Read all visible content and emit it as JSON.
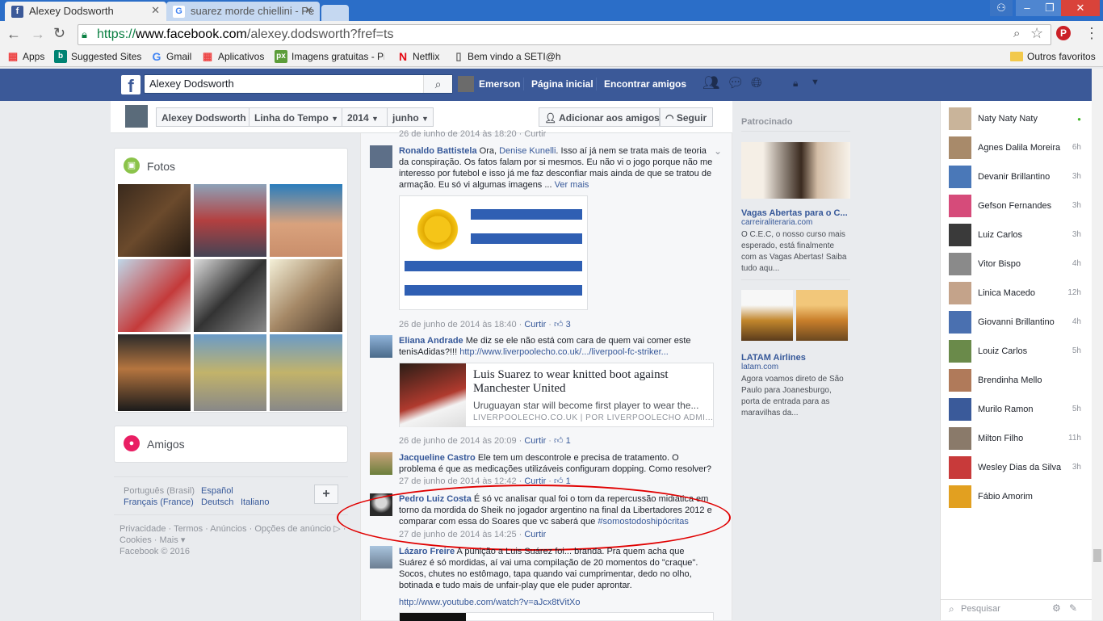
{
  "browser": {
    "tabs": [
      {
        "label": "Alexey Dodsworth"
      },
      {
        "label": "suarez morde chiellini - Pe"
      }
    ],
    "url_secure": "https://",
    "url_domain": "www.facebook.com",
    "url_path": "/alexey.dodsworth?fref=ts",
    "bookmarks": [
      "Apps",
      "Suggested Sites",
      "Gmail",
      "Aplicativos",
      "Imagens gratuitas - Pi",
      "Netflix",
      "Bem vindo a SETI@ho",
      "Outros favoritos"
    ]
  },
  "fb": {
    "search_value": "Alexey Dodsworth",
    "user": "Emerson",
    "nav_home": "Página inicial",
    "nav_friends": "Encontrar amigos"
  },
  "timeline": {
    "name": "Alexey Dodsworth",
    "tab": "Linha do Tempo",
    "year": "2014",
    "month": "junho",
    "add_friend": "Adicionar aos amigos",
    "follow": "Seguir"
  },
  "left": {
    "photos_title": "Fotos",
    "friends_title": "Amigos",
    "languages": [
      "Português (Brasil)",
      "Español",
      "Français (France)",
      "Deutsch",
      "Italiano"
    ],
    "footer_links": [
      "Privacidade",
      "Termos",
      "Anúncios",
      "Opções de anúncio",
      "Cookies",
      "Mais"
    ],
    "copyright": "Facebook © 2016"
  },
  "comments": {
    "top_meta": "26 de junho de 2014 às 18:20 · Curtir",
    "c1_name": "Ronaldo Battistela",
    "c1_text": "Ora, ",
    "c1_mention": "Denise Kunelli",
    "c1_text2": ". Isso aí já nem se trata mais de teoria da conspiração. Os fatos falam por si mesmos. Eu não vi o jogo porque não me interesso por futebol e isso já me faz desconfiar mais ainda de que se tratou de armação. Eu só vi algumas imagens ... ",
    "c1_more": "Ver mais",
    "c1_date": "26 de junho de 2014 às 18:40",
    "c1_like": "Curtir",
    "c1_likes": "3",
    "c2_name": "Eliana Andrade",
    "c2_text": "Me diz se ele não está com cara de quem vai comer este tenisAdidas?!!! ",
    "c2_link": "http://www.liverpoolecho.co.uk/.../liverpool-fc-striker...",
    "c2_card_title": "Luis Suarez to wear knitted boot against Manchester United",
    "c2_card_desc": "Uruguayan star will become first player to wear the...",
    "c2_card_src": "LIVERPOOLECHO.CO.UK | POR LIVERPOOLECHO ADMI...",
    "c2_date": "26 de junho de 2014 às 20:09",
    "c2_like": "Curtir",
    "c2_likes": "1",
    "c3_name": "Jacqueline Castro",
    "c3_text": "Ele tem um descontrole e precisa de tratamento. O problema é que as medicações utilizáveis configuram dopping. Como resolver?",
    "c3_date": "27 de junho de 2014 às 12:42",
    "c3_like": "Curtir",
    "c3_likes": "1",
    "c4_name": "Pedro Luiz Costa",
    "c4_text": "É só vc analisar qual foi o tom da repercussão midiática em torno da mordida do Sheik no jogador argentino na final da Libertadores 2012 e comparar com essa do Soares que vc saberá que ",
    "c4_tag": "#somostodoshipócritas",
    "c4_date": "27 de junho de 2014 às 14:25",
    "c4_like": "Curtir",
    "c5_name": "Lázaro Freire",
    "c5_text": "A punição a Luis Suárez foi... branda. Pra quem acha que Suárez é só mordidas, aí vai uma compilação de 20 momentos do \"craque\". Socos, chutes no estômago, tapa quando vai cumprimentar, dedo no olho, botinada e tudo mais de unfair-play que ele puder aprontar.",
    "c5_link": "http://www.youtube.com/watch?v=aJcx8tVitXo"
  },
  "sponsored": {
    "title": "Patrocinado",
    "ad1_title": "Vagas Abertas para o C...",
    "ad1_domain": "carreiraliteraria.com",
    "ad1_text": "O C.E.C, o nosso curso mais esperado, está finalmente com as Vagas Abertas! Saiba tudo aqu...",
    "ad2_title": "LATAM Airlines",
    "ad2_domain": "latam.com",
    "ad2_text": "Agora voamos direto de São Paulo para Joanesburgo, porta de entrada para as maravilhas da..."
  },
  "chat": {
    "items": [
      {
        "name": "Naty Naty Naty",
        "time": "●"
      },
      {
        "name": "Agnes Dalila Moreira",
        "time": "6h"
      },
      {
        "name": "Devanir Brillantino",
        "time": "3h"
      },
      {
        "name": "Gefson Fernandes",
        "time": "3h"
      },
      {
        "name": "Luiz Carlos",
        "time": "3h"
      },
      {
        "name": "Vitor Bispo",
        "time": "4h"
      },
      {
        "name": "Linica Macedo",
        "time": "12h"
      },
      {
        "name": "Giovanni Brillantino",
        "time": "4h"
      },
      {
        "name": "Louiz Carlos",
        "time": "5h"
      },
      {
        "name": "Brendinha Mello",
        "time": ""
      },
      {
        "name": "Murilo Ramon",
        "time": "5h"
      },
      {
        "name": "Milton Filho",
        "time": "11h"
      },
      {
        "name": "Wesley Dias da Silva",
        "time": "3h"
      },
      {
        "name": "Fábio Amorim",
        "time": ""
      }
    ],
    "search_placeholder": "Pesquisar"
  },
  "colors": {
    "fb_blue": "#3b5998",
    "link": "#365899",
    "highlight_red": "#e00000",
    "online": "#42b72a"
  }
}
